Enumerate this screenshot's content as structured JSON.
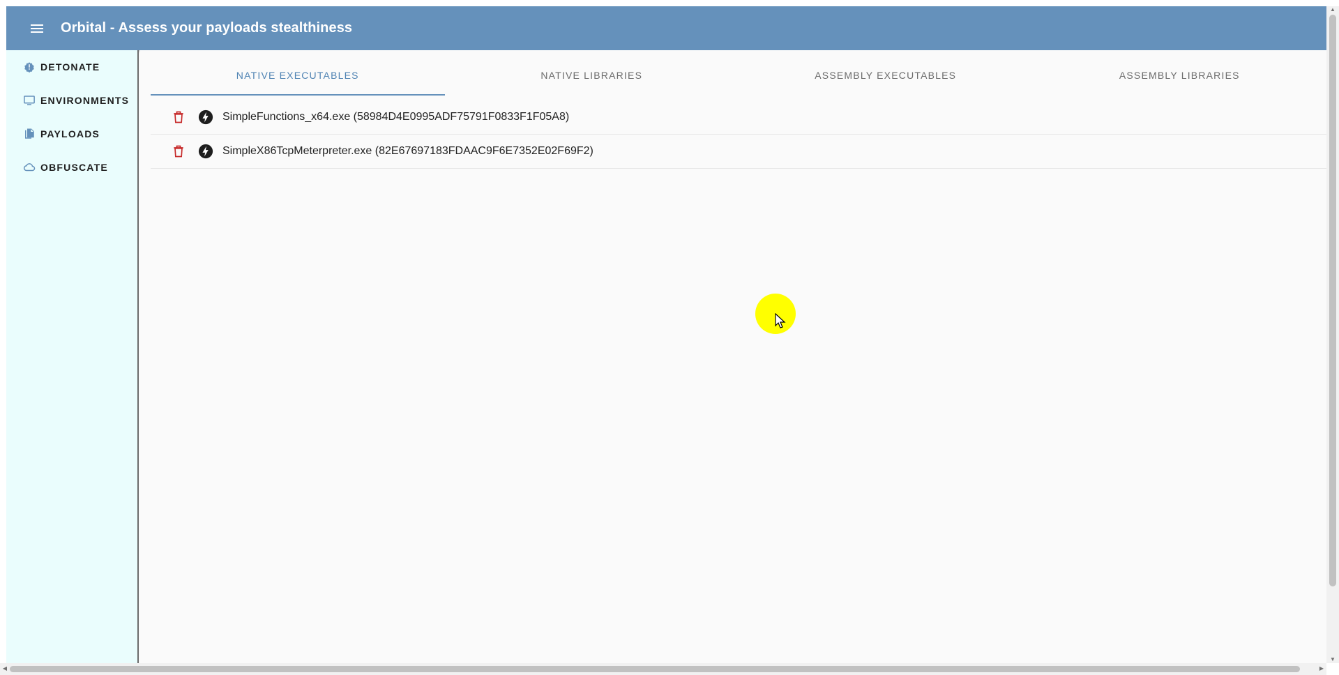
{
  "app": {
    "title": "Orbital - Assess your payloads stealthiness",
    "menu_icon": "menu-icon"
  },
  "sidebar": {
    "items": [
      {
        "label": "DETONATE",
        "icon": "bug-icon"
      },
      {
        "label": "ENVIRONMENTS",
        "icon": "monitor-icon"
      },
      {
        "label": "PAYLOADS",
        "icon": "file-copy-icon"
      },
      {
        "label": "OBFUSCATE",
        "icon": "cloud-icon"
      }
    ]
  },
  "tabs": [
    {
      "label": "NATIVE EXECUTABLES",
      "active": true
    },
    {
      "label": "NATIVE LIBRARIES",
      "active": false
    },
    {
      "label": "ASSEMBLY EXECUTABLES",
      "active": false
    },
    {
      "label": "ASSEMBLY LIBRARIES",
      "active": false
    }
  ],
  "payloads": [
    {
      "text": "SimpleFunctions_x64.exe (58984D4E0995ADF75791F0833F1F05A8)"
    },
    {
      "text": "SimpleX86TcpMeterpreter.exe (82E67697183FDAAC9F6E7352E02F69F2)"
    }
  ],
  "colors": {
    "appbar": "#6591bb",
    "sidebar_bg": "#eafdfd",
    "active_tab": "#4f83b3",
    "delete_icon": "#c62828",
    "cursor_highlight": "#ffff00"
  }
}
